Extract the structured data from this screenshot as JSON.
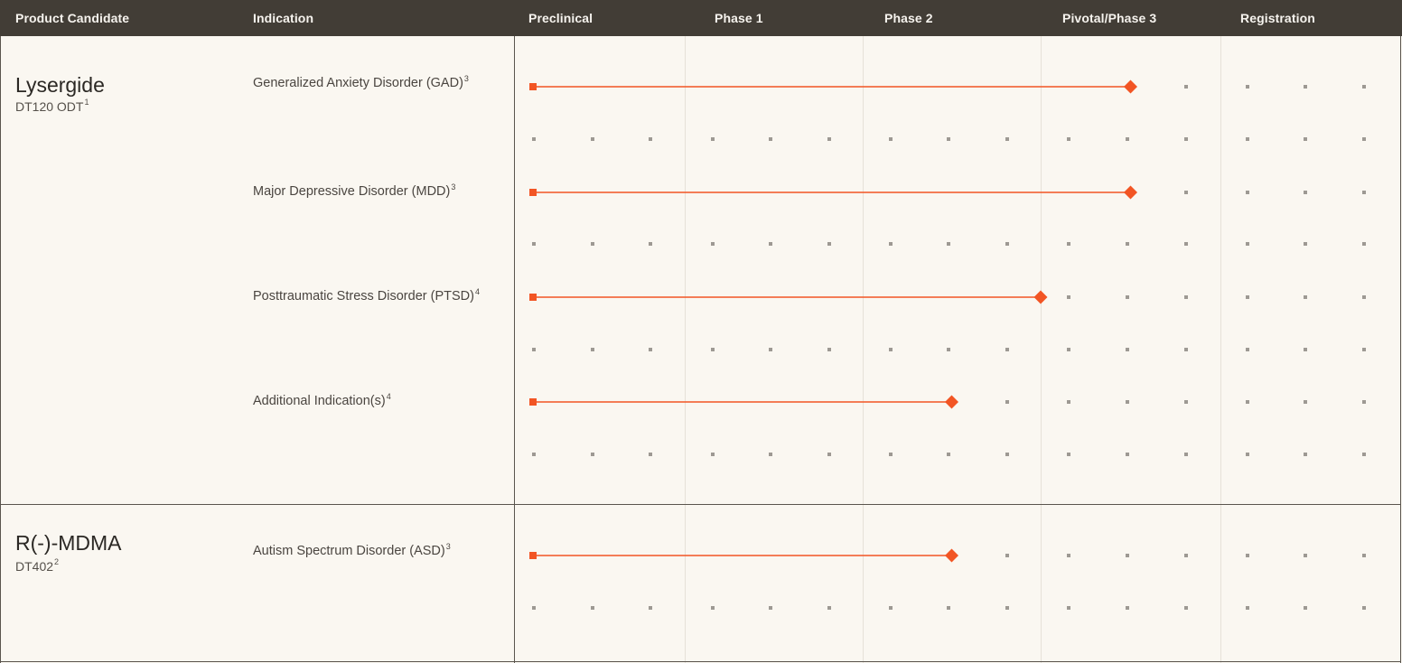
{
  "header": {
    "product_candidate": "Product Candidate",
    "indication": "Indication"
  },
  "chart_data": {
    "type": "table",
    "stages": [
      "Preclinical",
      "Phase 1",
      "Phase 2",
      "Pivotal/Phase 3",
      "Registration"
    ],
    "products": [
      {
        "name": "Lysergide",
        "code": "DT120 ODT",
        "code_footnote": "1",
        "indications": [
          {
            "label": "Generalized Anxiety Disorder (GAD)",
            "footnote": "3",
            "progress": 3.5
          },
          {
            "label": "Major Depressive Disorder (MDD)",
            "footnote": "3",
            "progress": 3.5
          },
          {
            "label": "Posttraumatic Stress Disorder (PTSD)",
            "footnote": "4",
            "progress": 3.0
          },
          {
            "label": "Additional Indication(s)",
            "footnote": "4",
            "progress": 2.5
          }
        ]
      },
      {
        "name": "R(-)-MDMA",
        "code": "DT402",
        "code_footnote": "2",
        "indications": [
          {
            "label": "Autism Spectrum Disorder (ASD)",
            "footnote": "3",
            "progress": 2.5
          }
        ]
      }
    ],
    "colors": {
      "header_bg": "#423d36",
      "header_text": "#f6f3ee",
      "background": "#faf7f1",
      "bar": "#f25524",
      "dot": "#9d9993"
    }
  }
}
